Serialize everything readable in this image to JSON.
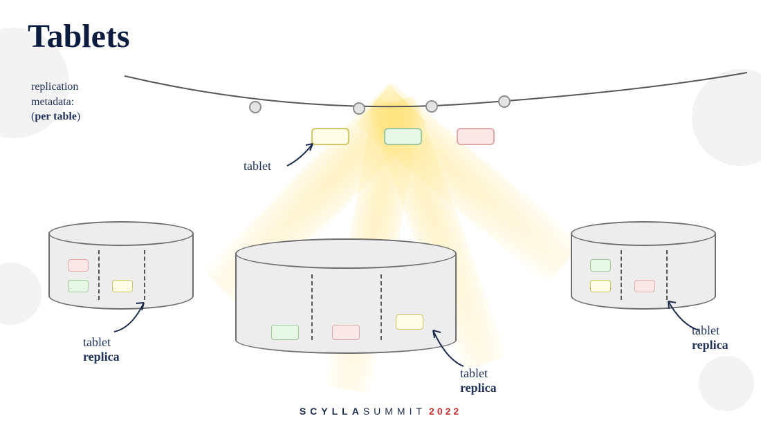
{
  "title": "Tablets",
  "metadata_label": {
    "line1": "replication",
    "line2": "metadata:",
    "line3_pre": "(",
    "line3_bold": "per table",
    "line3_post": ")"
  },
  "tablet_label": "tablet",
  "replica_labels": {
    "left": {
      "line1": "tablet",
      "line2_bold": "replica"
    },
    "mid": {
      "line1": "tablet",
      "line2_bold": "replica"
    },
    "right": {
      "line1": "tablet",
      "line2_bold": "replica"
    }
  },
  "footer": {
    "brand_a": "SCYLLA",
    "brand_b": "SUMMIT",
    "year": "2022"
  },
  "colors": {
    "text": "#0c1c3f",
    "yellow": "#fffde6",
    "green": "#e8f8e6",
    "pink": "#fbe7e6"
  },
  "ring": {
    "nodes": 4,
    "tablets": [
      "yellow",
      "green",
      "pink"
    ]
  },
  "cylinders": {
    "left": {
      "columns": 3,
      "boxes": [
        {
          "col": 0,
          "color": "pink",
          "row": 0
        },
        {
          "col": 0,
          "color": "green",
          "row": 1
        },
        {
          "col": 1,
          "color": "yellow",
          "row": 1
        }
      ]
    },
    "mid": {
      "columns": 3,
      "boxes": [
        {
          "col": 0,
          "color": "green",
          "row": 1
        },
        {
          "col": 1,
          "color": "pink",
          "row": 1
        },
        {
          "col": 2,
          "color": "yellow",
          "row": 0
        }
      ]
    },
    "right": {
      "columns": 3,
      "boxes": [
        {
          "col": 0,
          "color": "green",
          "row": 0
        },
        {
          "col": 0,
          "color": "yellow",
          "row": 1
        },
        {
          "col": 1,
          "color": "pink",
          "row": 1
        }
      ]
    }
  }
}
